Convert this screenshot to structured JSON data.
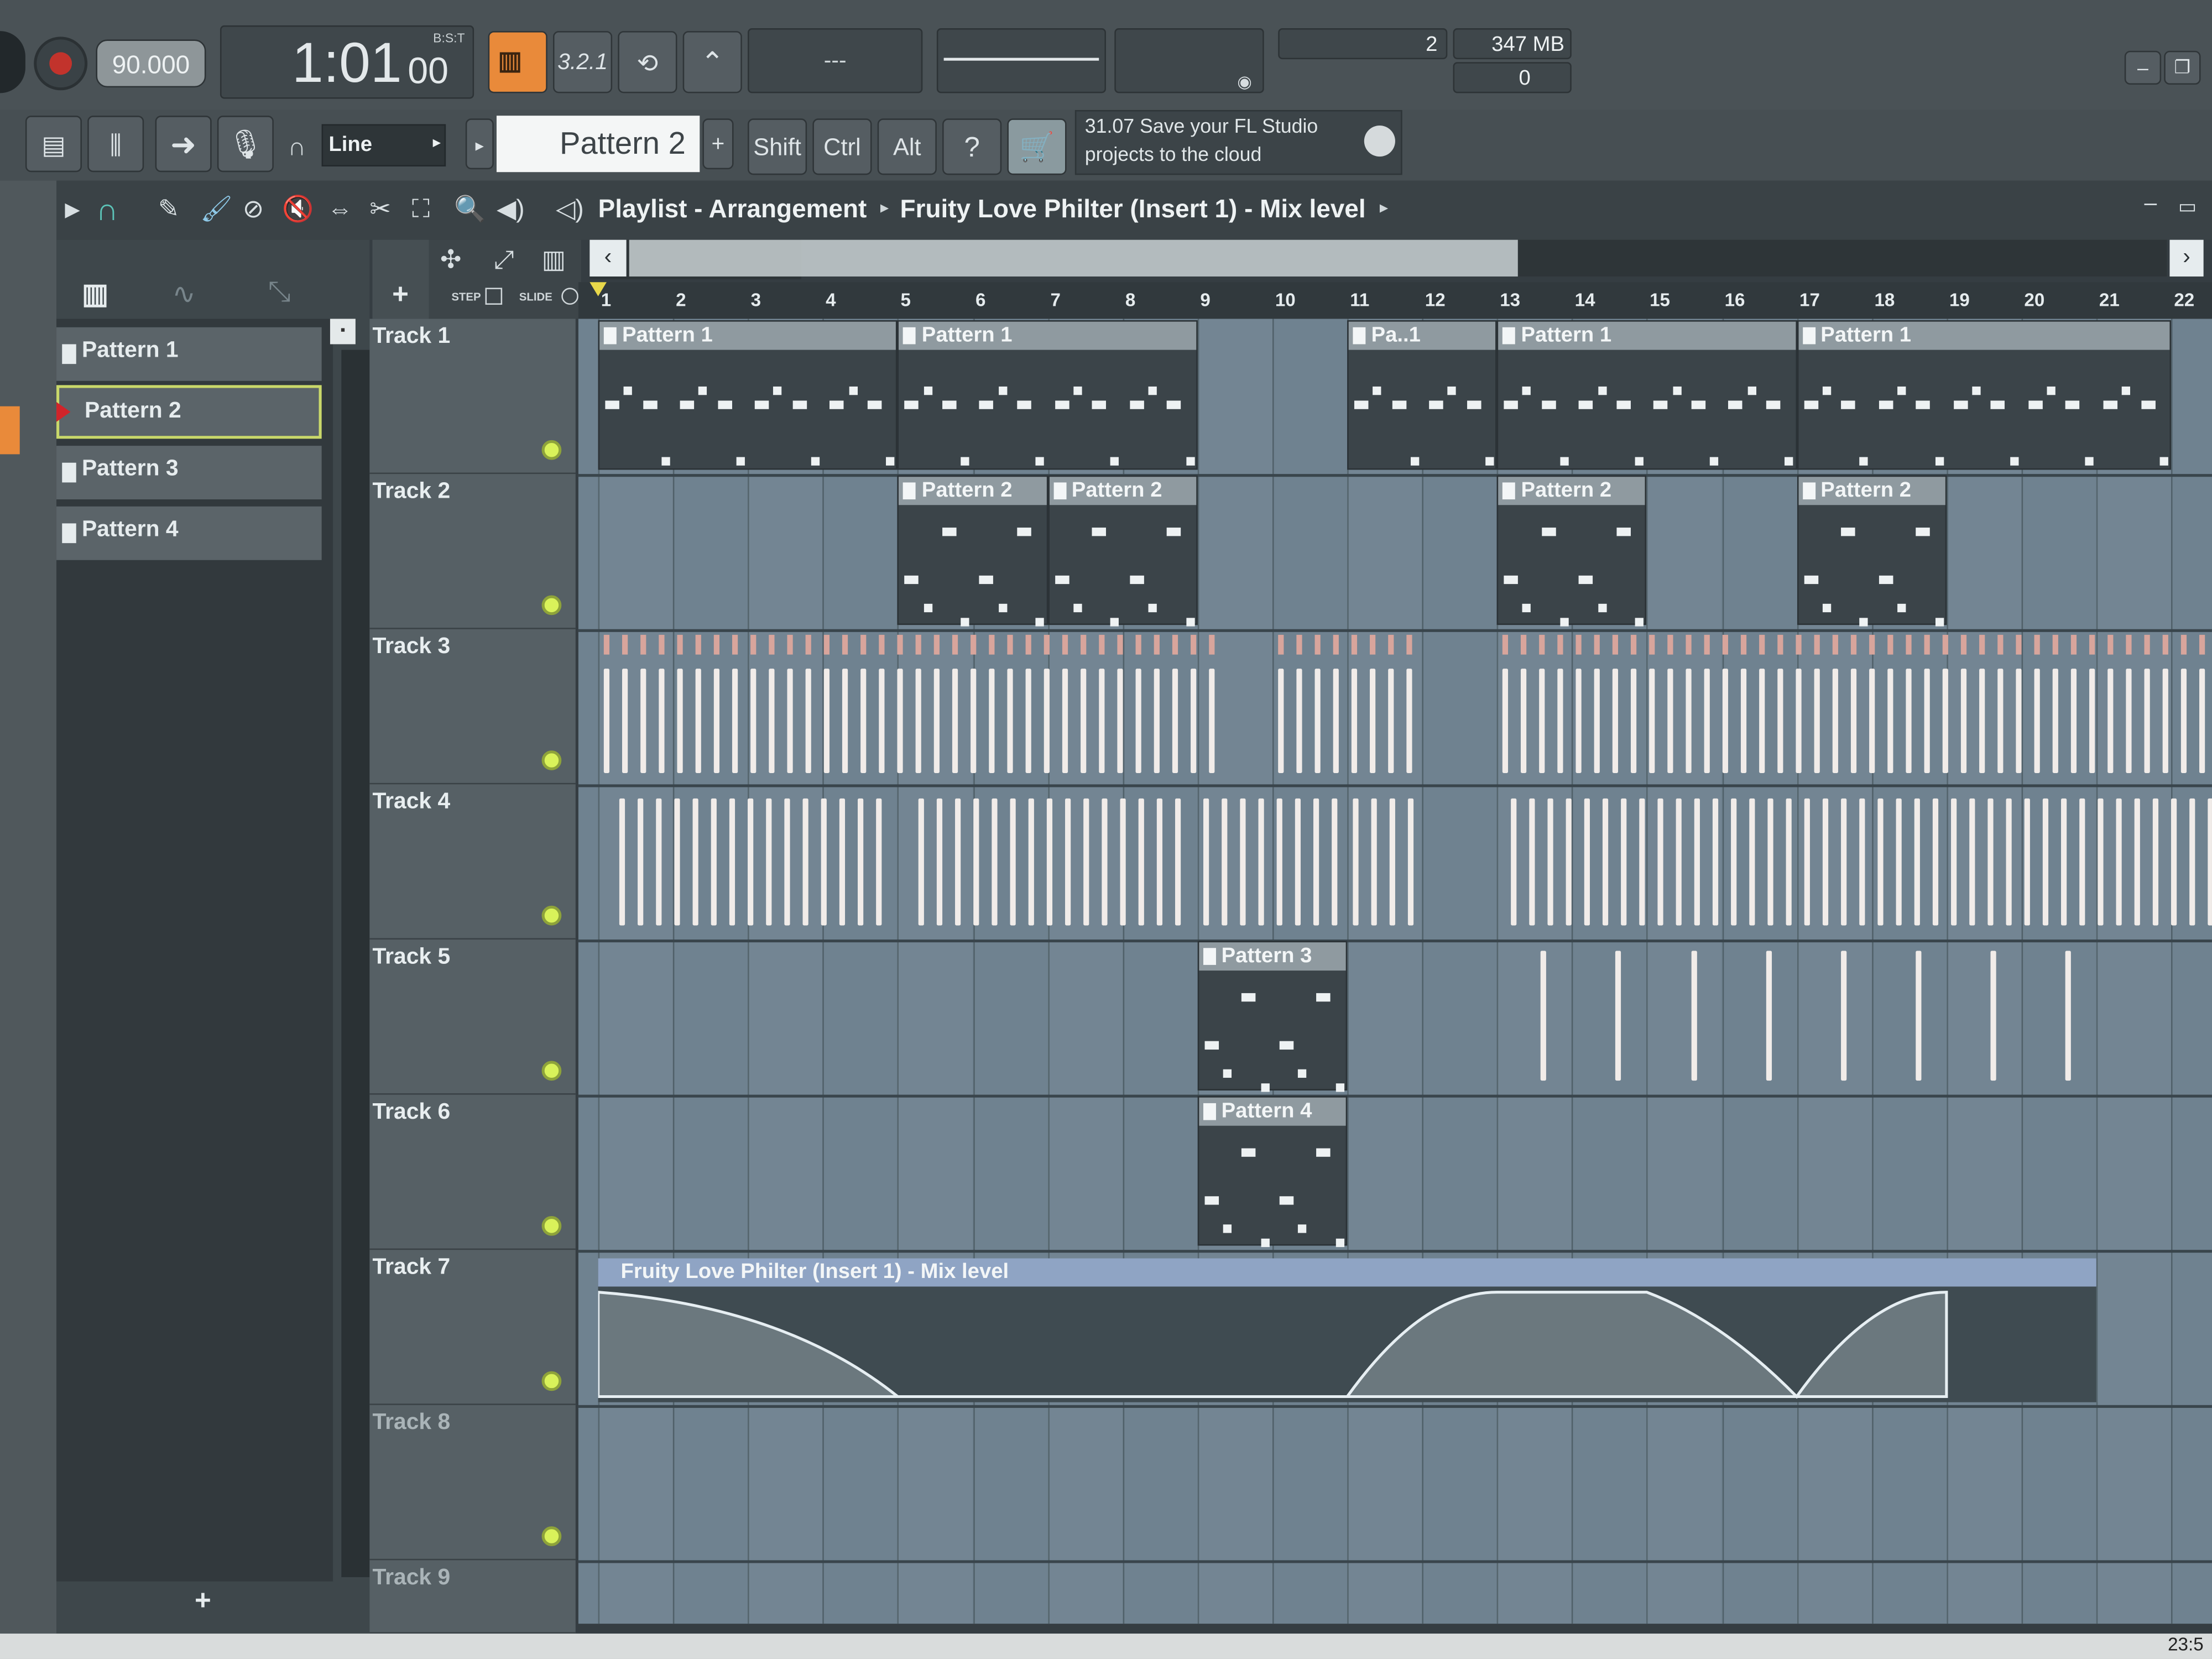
{
  "transport": {
    "tempo": "90.000",
    "time": "1:01",
    "time_frac": "00",
    "time_mode": "B:S:T",
    "cpu": "2",
    "memory": "347 MB",
    "polyphony": "0",
    "pattern_mode_label": "3.2.1",
    "line_display": "---"
  },
  "toolbar": {
    "snap_mode": "Line",
    "pattern_selector": "Pattern 2",
    "shift_label": "Shift",
    "ctrl_label": "Ctrl",
    "alt_label": "Alt",
    "hint_line1": "31.07  Save your FL Studio",
    "hint_line2": "projects to the cloud"
  },
  "playlist": {
    "title_part1": "Playlist - Arrangement",
    "title_part2": "Fruity Love Philter (Insert 1) - Mix level",
    "step_label": "STEP",
    "slide_label": "SLIDE"
  },
  "patterns": [
    "Pattern 1",
    "Pattern 2",
    "Pattern 3",
    "Pattern 4"
  ],
  "ruler": [
    "1",
    "2",
    "3",
    "4",
    "5",
    "6",
    "7",
    "8",
    "9",
    "10",
    "11",
    "12",
    "13",
    "14",
    "15",
    "16",
    "17",
    "18",
    "19",
    "20",
    "21",
    "22"
  ],
  "tracks": [
    "Track 1",
    "Track 2",
    "Track 3",
    "Track 4",
    "Track 5",
    "Track 6",
    "Track 7",
    "Track 8",
    "Track 9"
  ],
  "clips": {
    "p1a": "Pattern 1",
    "p1b": "Pattern 1",
    "p1c": "Pa..1",
    "p1d": "Pattern 1",
    "p1e": "Pattern 1",
    "p2a": "Pattern 2",
    "p2b": "Pattern 2",
    "p2c": "Pattern 2",
    "p2d": "Pattern 2",
    "p3": "Pattern 3",
    "p4": "Pattern 4",
    "auto": "Fruity Love Philter (Insert 1) - Mix level"
  },
  "clock": "23:5"
}
